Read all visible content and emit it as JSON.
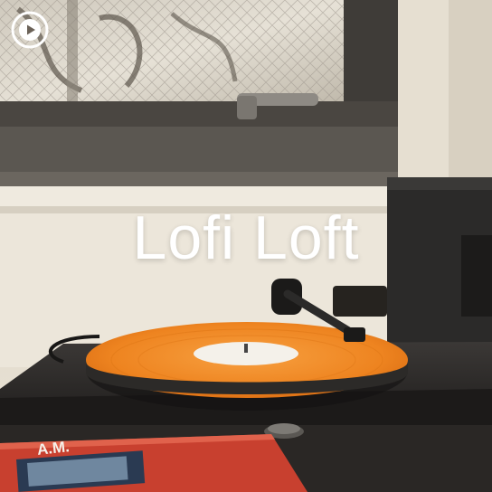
{
  "playlist": {
    "title": "Lofi Loft"
  },
  "icons": {
    "badge": "play-circle-icon"
  },
  "scene": {
    "record_label_lettering": "A.M."
  },
  "colors": {
    "vinyl": "#f08a24",
    "title_text": "#ffffff",
    "wall": "#e8e1d3",
    "turntable": "#2c2b2a"
  }
}
